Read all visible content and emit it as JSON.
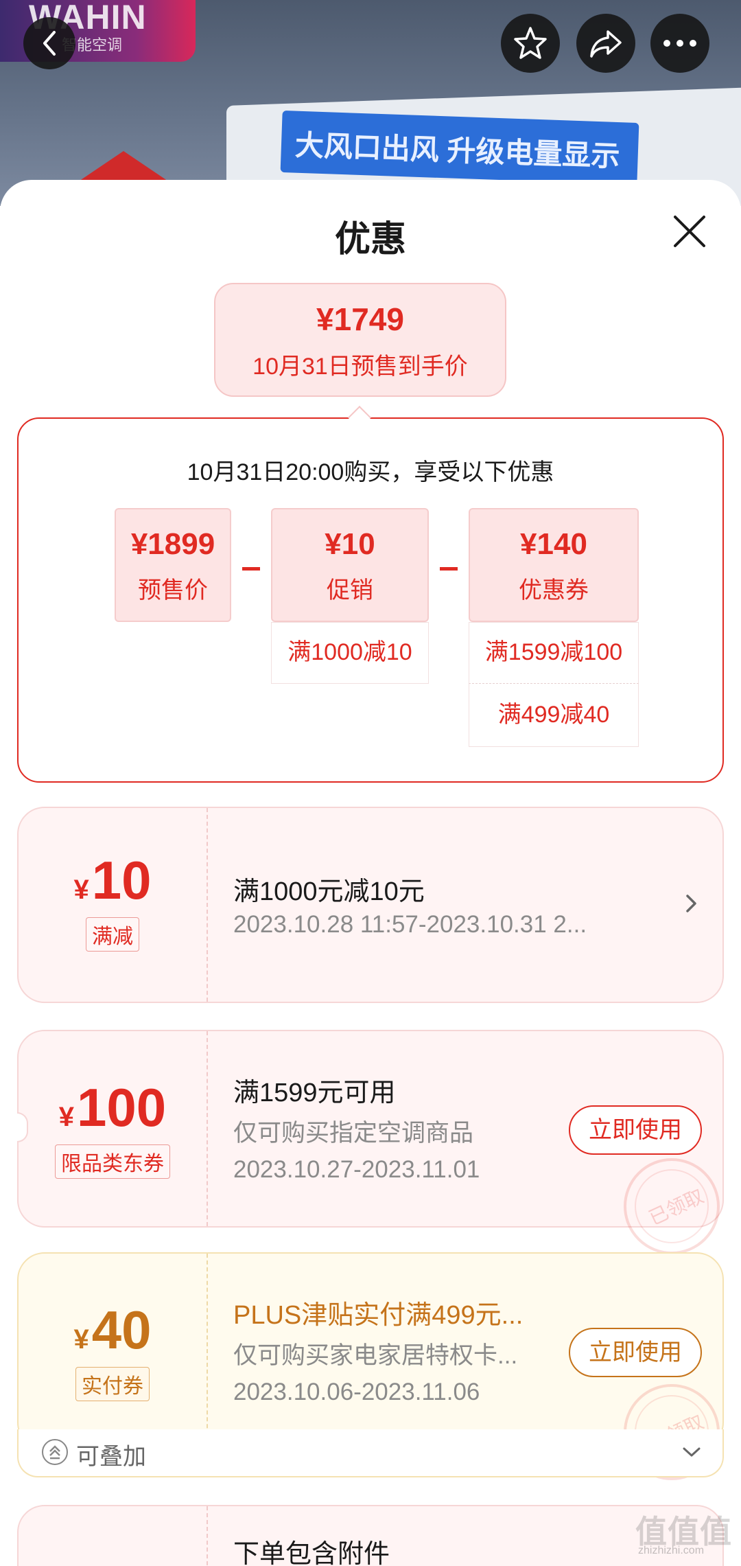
{
  "hero": {
    "brand_logo": "WAHIN",
    "brand_sub": "智能空调",
    "banner": "大风口出风 升级电量显示"
  },
  "sheet": {
    "title": "优惠"
  },
  "price_bubble": {
    "amount": "¥1749",
    "label": "10月31日预售到手价"
  },
  "calc": {
    "heading": "10月31日20:00购买，享受以下优惠",
    "items": [
      {
        "value": "¥1899",
        "label": "预售价"
      },
      {
        "value": "¥10",
        "label": "促销"
      },
      {
        "value": "¥140",
        "label": "优惠券"
      }
    ],
    "promo_details": [
      "满1000减10"
    ],
    "coupon_details": [
      "满1599减100",
      "满499减40"
    ]
  },
  "coupons": [
    {
      "currency": "¥",
      "amount": "10",
      "tag": "满减",
      "title": "满1000元减10元",
      "desc": "",
      "date": "2023.10.28 11:57-2023.10.31 2...",
      "button": ""
    },
    {
      "currency": "¥",
      "amount": "100",
      "tag": "限品类东券",
      "title": "满1599元可用",
      "desc": "仅可购买指定空调商品",
      "date": "2023.10.27-2023.11.01",
      "button": "立即使用",
      "stamp": "已领取"
    },
    {
      "currency": "¥",
      "amount": "40",
      "tag": "实付券",
      "title": "PLUS津贴实付满499元...",
      "desc": "仅可购买家电家居特权卡...",
      "date": "2023.10.06-2023.11.06",
      "button": "立即使用",
      "stamp": "已领取"
    },
    {
      "title": "下单包含附件"
    }
  ],
  "stack": {
    "label": "可叠加"
  },
  "watermark": {
    "main": "值值值",
    "sub": "zhizhizhi.com"
  },
  "colors": {
    "accent_red": "#e02a22",
    "gold": "#c5731a",
    "pink_bg": "#fde8e8"
  }
}
